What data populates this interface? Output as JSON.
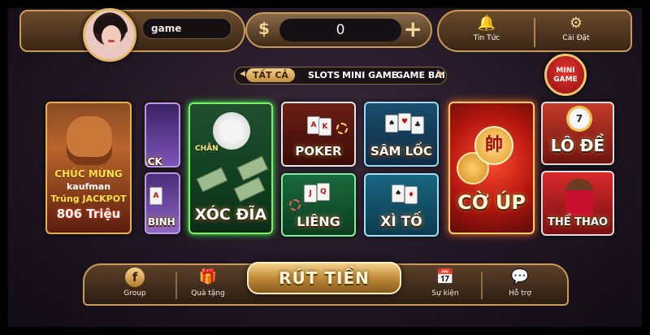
{
  "header": {
    "username": "game",
    "balance": "0",
    "currency_symbol": "$",
    "plus_symbol": "+",
    "news_label": "Tin Tức",
    "settings_label": "Cài Đặt"
  },
  "tabs": [
    {
      "label": "TẤT CẢ",
      "active": true
    },
    {
      "label": "SLOTS",
      "active": false
    },
    {
      "label": "MINI GAME",
      "active": false
    },
    {
      "label": "GAME BÀI",
      "active": false
    }
  ],
  "mini_game_badge": {
    "line1": "MINI",
    "line2": "GAME"
  },
  "jackpot_banner": {
    "line1": "CHÚC MỪNG",
    "line2": "kaufman",
    "line3": "Trúng JACKPOT",
    "line4": "806 Triệu"
  },
  "games": {
    "blackjack": "K JACK",
    "binh": "BINH",
    "xocdia": "XÓC ĐĨA",
    "xocdia_chan": "CHẴN",
    "poker": "POKER",
    "samloc": "SÂM LỐC",
    "lieng": "LIÊNG",
    "xito": "XÌ TỐ",
    "coup": "CỜ ÚP",
    "coup_piece": "帥",
    "lode": "LÔ ĐỀ",
    "lode_ball": "7",
    "thethao": "THỂ THAO"
  },
  "bottom": {
    "group_label": "Group",
    "gift_label": "Quà tặng",
    "withdraw_label": "RÚT TIỀN",
    "event_label": "Sự kiện",
    "support_label": "Hỗ trợ"
  },
  "colors": {
    "gold": "#c99a5a",
    "accent_red": "#e8352f",
    "xocdia_glow": "#3bff4a"
  }
}
